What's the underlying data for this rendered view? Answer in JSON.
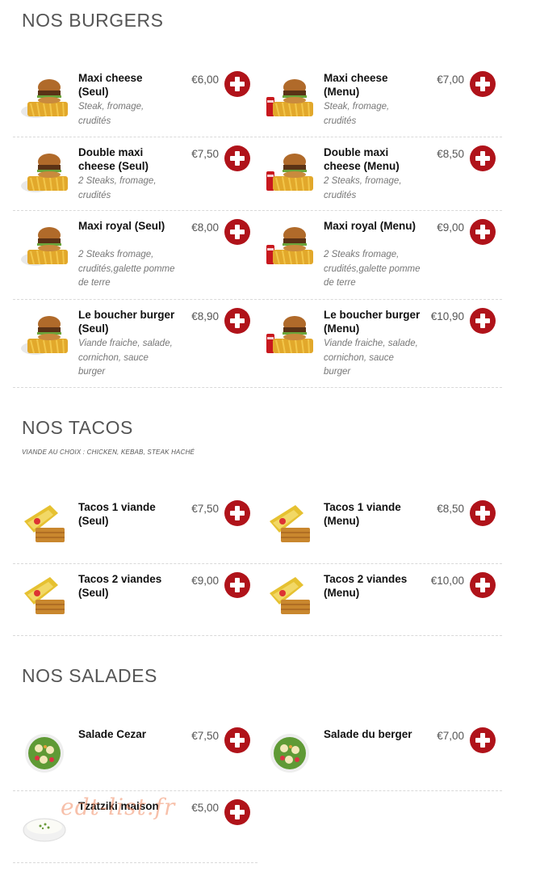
{
  "sections": {
    "burgers": {
      "title": "NOS BURGERS"
    },
    "tacos": {
      "title": "NOS TACOS",
      "subtitle": "VIANDE AU CHOIX : CHICKEN, KEBAB, STEAK HACHÉ"
    },
    "salades": {
      "title": "NOS SALADES"
    }
  },
  "items": [
    {
      "name": "Maxi cheese (Seul)",
      "desc": "Steak, fromage, crudités",
      "price": "€6,00",
      "icon": "burger-fries-icon"
    },
    {
      "name": "Maxi cheese (Menu)",
      "desc": "Steak, fromage, crudités",
      "price": "€7,00",
      "icon": "burger-menu-icon"
    },
    {
      "name": "Double maxi cheese (Seul)",
      "desc": "2 Steaks, fromage, crudités",
      "price": "€7,50",
      "icon": "burger-fries-icon"
    },
    {
      "name": "Double maxi cheese (Menu)",
      "desc": "2 Steaks, fromage, crudités",
      "price": "€8,50",
      "icon": "burger-menu-icon"
    },
    {
      "name": "Maxi royal (Seul)",
      "desc": "2 Steaks fromage, crudités,galette pomme de terre",
      "price": "€8,00",
      "icon": "burger-fries-icon"
    },
    {
      "name": "Maxi royal (Menu)",
      "desc": "2 Steaks fromage, crudités,galette pomme de terre",
      "price": "€9,00",
      "icon": "burger-menu-icon"
    },
    {
      "name": "Le boucher burger (Seul)",
      "desc": "Viande fraiche, salade, cornichon, sauce burger",
      "price": "€8,90",
      "icon": "burger-fries-icon"
    },
    {
      "name": "Le boucher burger (Menu)",
      "desc": "Viande fraiche, salade, cornichon, sauce burger",
      "price": "€10,90",
      "icon": "burger-menu-icon"
    },
    {
      "name": "Tacos 1 viande (Seul)",
      "desc": "",
      "price": "€7,50",
      "icon": "tacos-icon"
    },
    {
      "name": "Tacos 1 viande (Menu)",
      "desc": "",
      "price": "€8,50",
      "icon": "tacos-icon"
    },
    {
      "name": "Tacos 2 viandes (Seul)",
      "desc": "",
      "price": "€9,00",
      "icon": "tacos-icon"
    },
    {
      "name": "Tacos 2 viandes (Menu)",
      "desc": "",
      "price": "€10,00",
      "icon": "tacos-icon"
    },
    {
      "name": "Salade Cezar",
      "desc": "",
      "price": "€7,50",
      "icon": "salad-icon"
    },
    {
      "name": "Salade du berger",
      "desc": "",
      "price": "€7,00",
      "icon": "salad-icon"
    },
    {
      "name": "Tzatziki maison",
      "desc": "",
      "price": "€5,00",
      "icon": "tzatziki-icon"
    }
  ],
  "watermark": "edt-list.fr",
  "colors": {
    "accent": "#b0131a",
    "title": "#555555",
    "desc": "#777777"
  }
}
